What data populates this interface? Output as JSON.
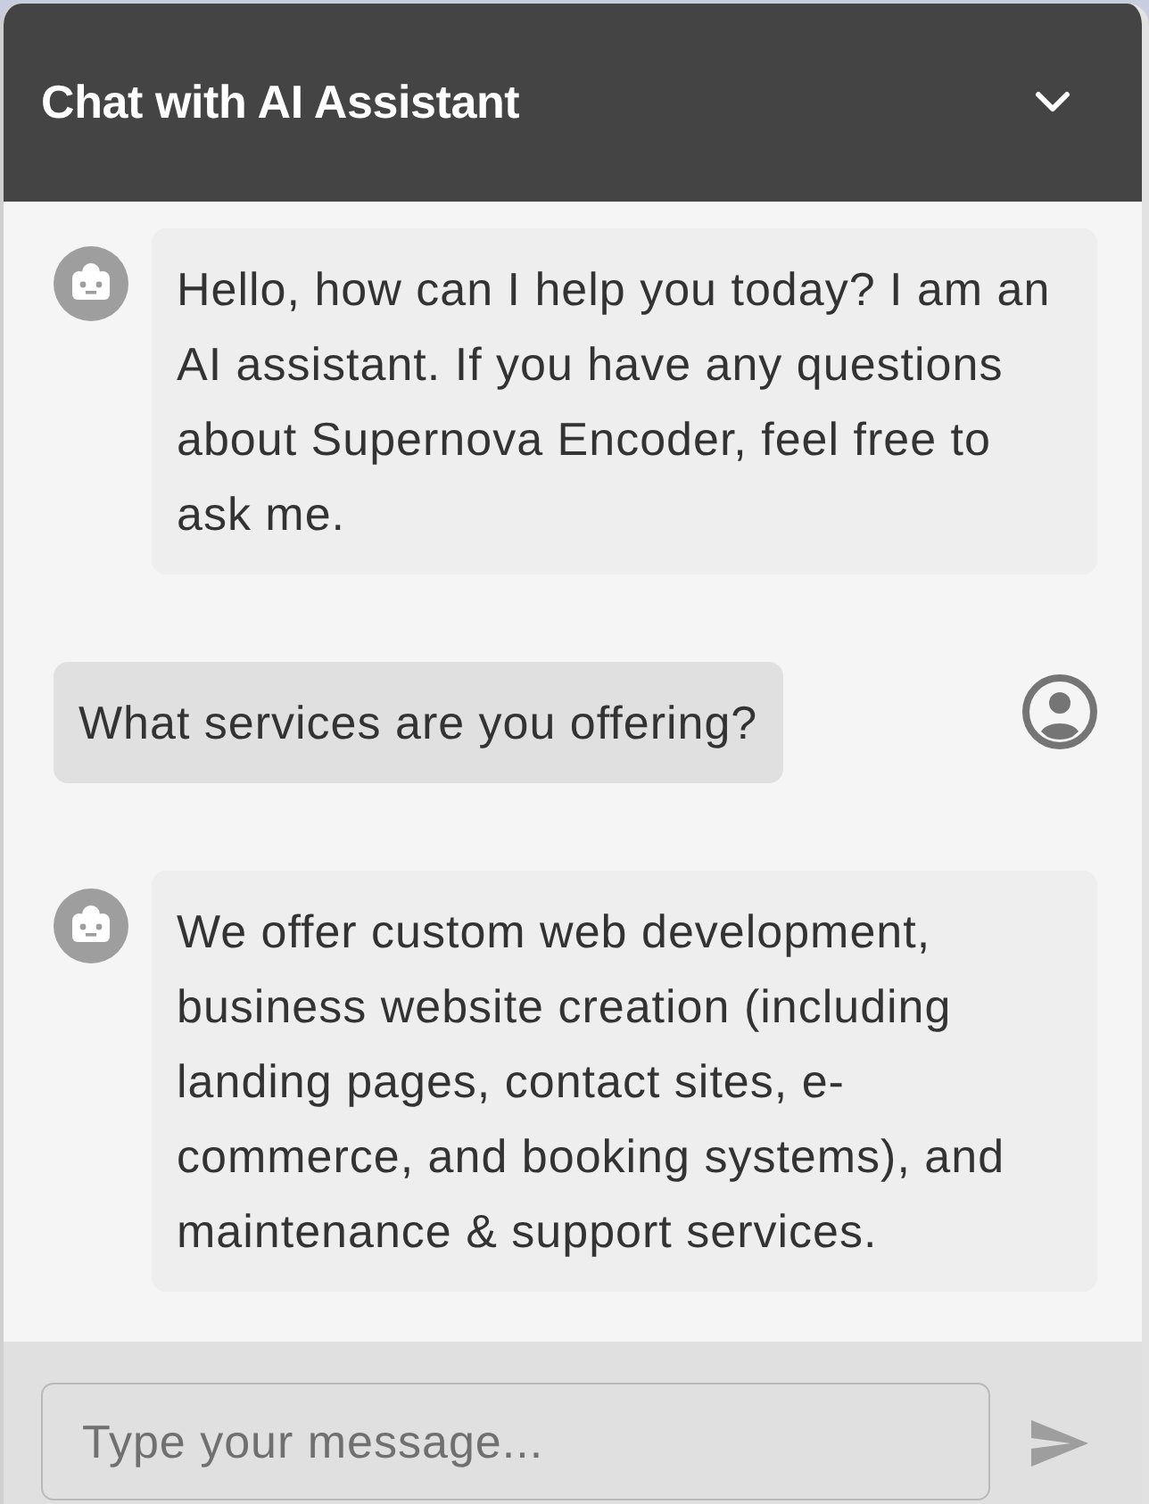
{
  "header": {
    "title": "Chat with AI Assistant"
  },
  "messages": [
    {
      "kind": "bot",
      "text": "Hello, how can I help you today? I am an AI assistant. If you have any questions about Supernova Encoder, feel free to ask me."
    },
    {
      "kind": "user",
      "text": "What services are you offering?"
    },
    {
      "kind": "bot",
      "text": "We offer custom web development, business website creation (including landing pages, contact sites, e-commerce, and booking systems), and maintenance & support services."
    }
  ],
  "composer": {
    "placeholder": "Type your message..."
  }
}
